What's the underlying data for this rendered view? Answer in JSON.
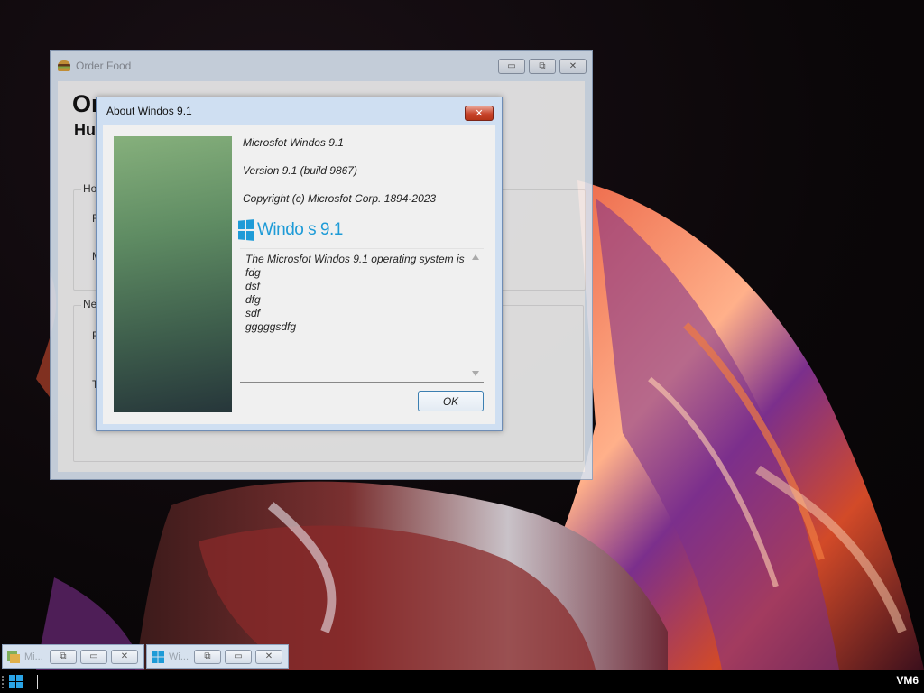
{
  "desktop": {
    "wallpaper": "abstract red/orange/purple swirl"
  },
  "order_window": {
    "title": "Order Food",
    "icon": "burger-icon",
    "heading": "Order food",
    "heading_visible": "Or",
    "subheading_visible": "Hu",
    "group1_legend": "Ho",
    "group1_labels": [
      "F",
      "M"
    ],
    "group2_legend": "New",
    "group2_labels": [
      "F",
      "T"
    ],
    "buttons": {
      "minimize": "▭",
      "restore": "⧉",
      "close": "✕"
    }
  },
  "about_dialog": {
    "title": "About Windos 9.1",
    "product": "Microsfot Windos 9.1",
    "version": "Version 9.1 (build 9867)",
    "copyright": "Copyright (c) Microsfot Corp. 1894-2023",
    "logo_text": "Windo s 9.1",
    "description_lines": [
      "The Microsfot Windos 9.1 operating system is",
      "fdg",
      "dsf",
      "dfg",
      "sdf",
      "gggggsdfg"
    ],
    "ok_label": "OK",
    "close_label": "✕"
  },
  "minimized_windows": [
    {
      "label": "Mi...",
      "icon": "app-icon"
    },
    {
      "label": "Wi...",
      "icon": "windows-logo-icon"
    }
  ],
  "taskbar": {
    "vm_label": "VM6"
  },
  "colors": {
    "accent_blue": "#1e9bd7",
    "close_red": "#c8442c",
    "window_frame": "#cfdff2"
  }
}
